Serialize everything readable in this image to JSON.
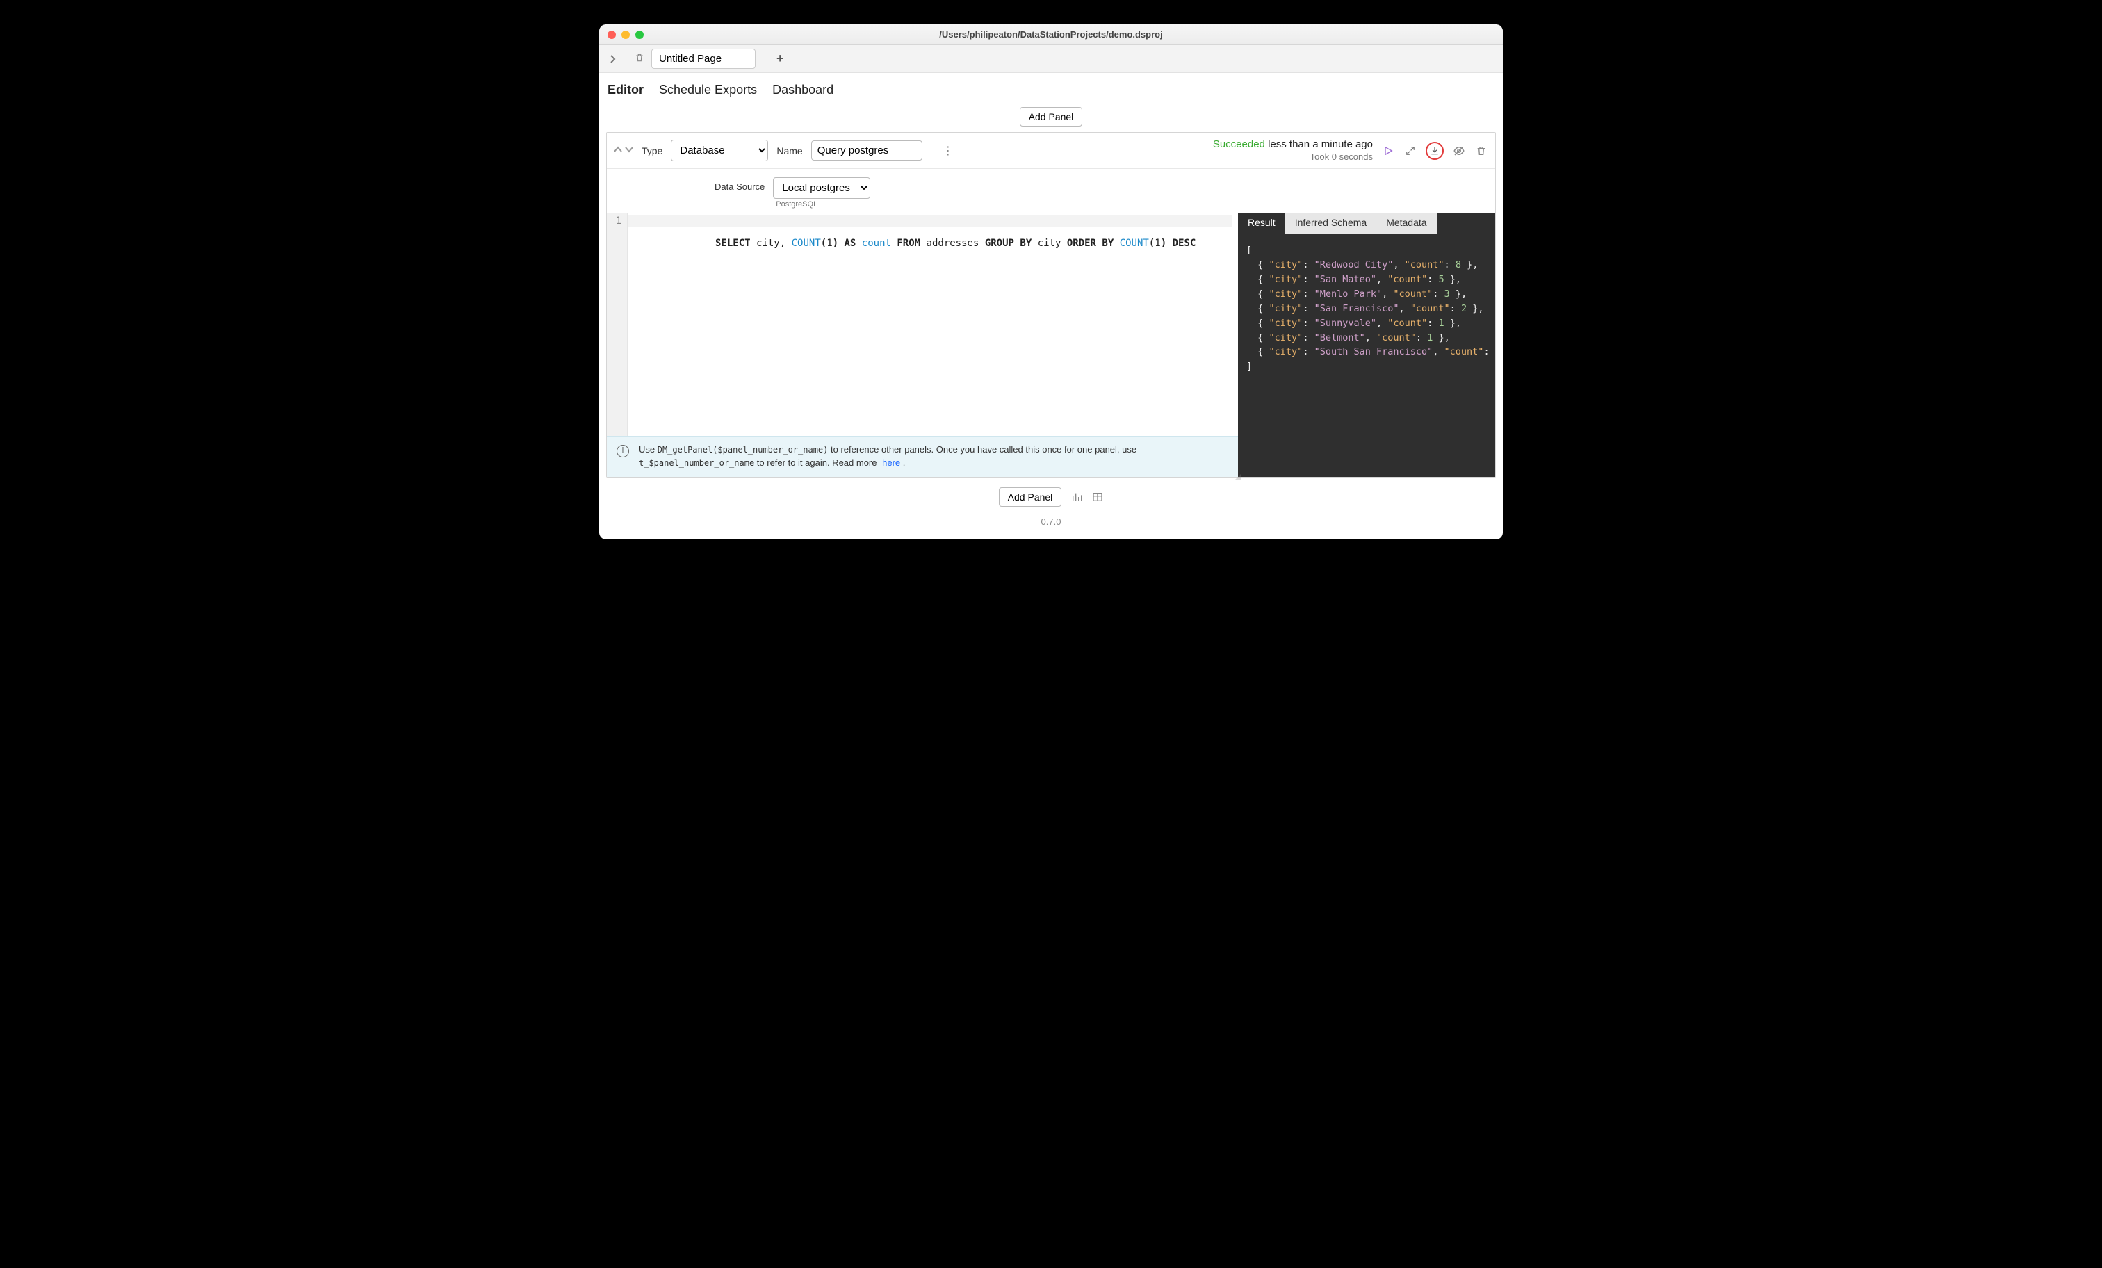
{
  "window": {
    "title": "/Users/philipeaton/DataStationProjects/demo.dsproj"
  },
  "page": {
    "name_value": "Untitled Page"
  },
  "mode_tabs": {
    "editor": "Editor",
    "schedule": "Schedule Exports",
    "dashboard": "Dashboard"
  },
  "buttons": {
    "add_panel": "Add Panel"
  },
  "panel": {
    "type_label": "Type",
    "type_value": "Database",
    "name_label": "Name",
    "name_value": "Query postgres",
    "status_word": "Succeeded",
    "status_suffix": "less than a minute ago",
    "status_duration": "Took 0 seconds",
    "data_source_label": "Data Source",
    "data_source_value": "Local postgres",
    "data_source_type": "PostgreSQL"
  },
  "code": {
    "line_no": "1",
    "tokens": {
      "select": "SELECT",
      "city": " city, ",
      "countfn": "COUNT",
      "p1": "(",
      "one1": "1",
      "p2": ")",
      "as": " AS ",
      "countcol": "count",
      "from": " FROM ",
      "tbl": "addresses ",
      "group": "GROUP BY",
      "city2": " city ",
      "order": "ORDER BY ",
      "countfn2": "COUNT",
      "p3": "(",
      "one2": "1",
      "p4": ") ",
      "desc": "DESC"
    }
  },
  "info": {
    "prefix": "Use ",
    "code1": "DM_getPanel($panel_number_or_name)",
    "mid": " to reference other panels. Once you have called this once for one panel, use ",
    "code2": "t_$panel_number_or_name",
    "suffix": " to refer to it again. Read more ",
    "link": "here",
    "dot": " ."
  },
  "result": {
    "tabs": {
      "result": "Result",
      "schema": "Inferred Schema",
      "meta": "Metadata"
    },
    "rows": [
      {
        "city": "Redwood City",
        "count": 8
      },
      {
        "city": "San Mateo",
        "count": 5
      },
      {
        "city": "Menlo Park",
        "count": 3
      },
      {
        "city": "San Francisco",
        "count": 2
      },
      {
        "city": "Sunnyvale",
        "count": 1
      },
      {
        "city": "Belmont",
        "count": 1
      },
      {
        "city": "South San Francisco",
        "count": null
      }
    ]
  },
  "version": "0.7.0"
}
